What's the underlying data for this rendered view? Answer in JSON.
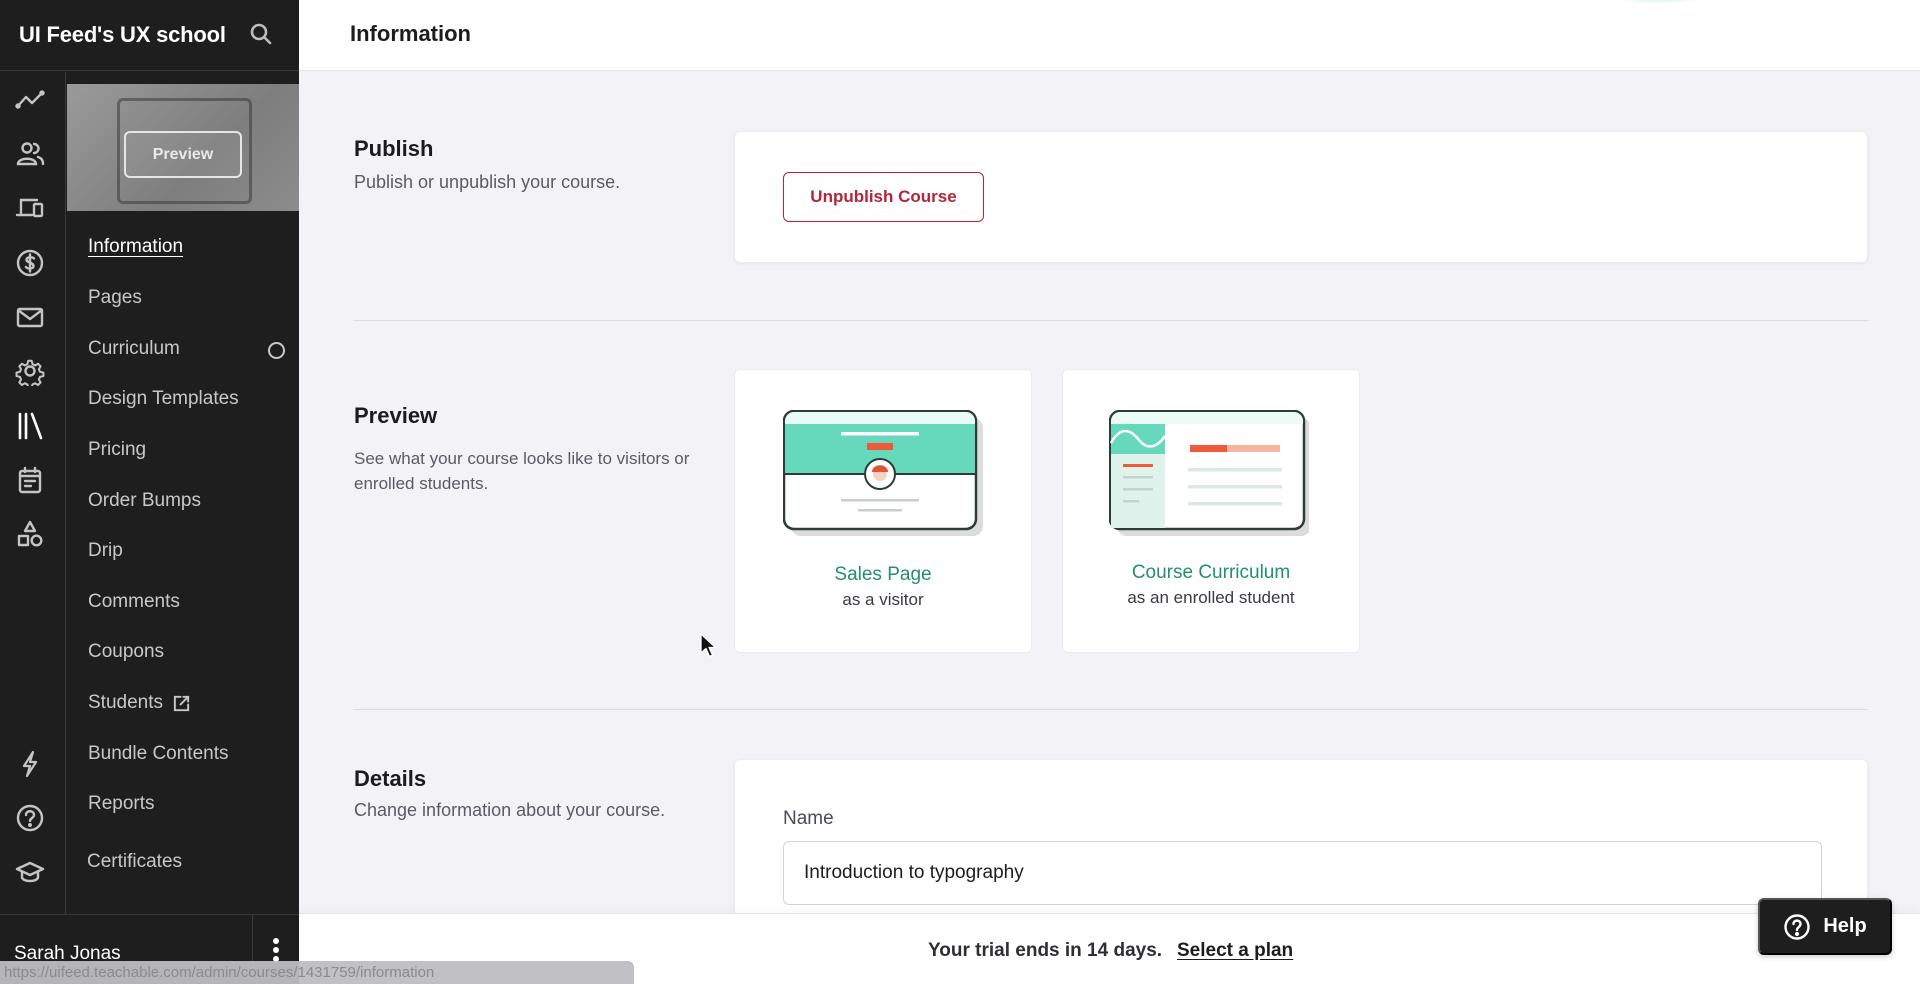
{
  "sidebar": {
    "brand": "UI Feed's UX school",
    "rail_icons": [
      "analytics-icon",
      "users-icon",
      "devices-icon",
      "dollar-icon",
      "mail-icon",
      "gear-icon",
      "library-icon",
      "calendar-icon",
      "shapes-icon",
      "lightning-icon",
      "help-circle-icon",
      "graduation-cap-icon"
    ],
    "thumbnail_button": "Preview",
    "nav": [
      {
        "label": "Information",
        "active": true
      },
      {
        "label": "Pages"
      },
      {
        "label": "Curriculum",
        "status": "incomplete"
      },
      {
        "label": "Design Templates"
      },
      {
        "label": "Pricing"
      },
      {
        "label": "Order Bumps"
      },
      {
        "label": "Drip"
      },
      {
        "label": "Comments"
      },
      {
        "label": "Coupons"
      },
      {
        "label": "Students",
        "external": true
      },
      {
        "label": "Bundle Contents"
      },
      {
        "label": "Reports"
      },
      {
        "label": "Certificates"
      }
    ],
    "user_name": "Sarah Jonas"
  },
  "header": {
    "title": "Information"
  },
  "publish": {
    "title": "Publish",
    "description": "Publish or unpublish your course.",
    "button": "Unpublish Course",
    "button_color": "#b2253a"
  },
  "preview": {
    "title": "Preview",
    "description": "See what your course looks like to visitors or enrolled students.",
    "cards": [
      {
        "title": "Sales Page",
        "subtitle": "as a visitor"
      },
      {
        "title": "Course Curriculum",
        "subtitle": "as an enrolled student"
      }
    ],
    "accent": "#228f6f"
  },
  "details": {
    "title": "Details",
    "description": "Change information about your course.",
    "name_label": "Name",
    "name_value": "Introduction to typography"
  },
  "trial": {
    "text": "Your trial ends in 14 days.",
    "link": "Select a plan"
  },
  "help": {
    "label": "Help"
  },
  "status_bar": {
    "url": "https://uifeed.teachable.com/admin/courses/1431759/information"
  }
}
